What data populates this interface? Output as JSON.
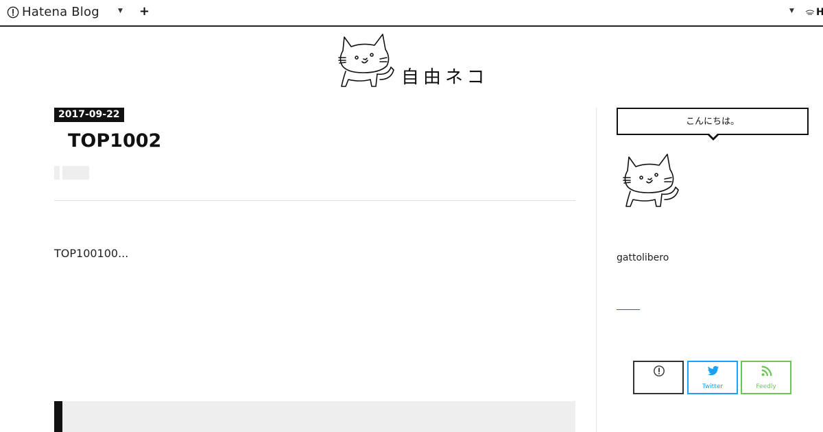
{
  "topbar": {
    "brand": "Hatena Blog",
    "add_label": "+",
    "user_initial": "H"
  },
  "header": {
    "site_title": "自由ネコ"
  },
  "entry": {
    "date": "2017-09-22",
    "title": "TOP1002",
    "body": "TOP100100..."
  },
  "sidebar": {
    "greeting": "こんにちは。",
    "profile_name": "gattolibero",
    "share_buttons": [
      {
        "label": "",
        "icon": "hatena-bookmark-icon",
        "color": "#333333"
      },
      {
        "label": "Twitter",
        "icon": "twitter-icon",
        "color": "#1da1f2"
      },
      {
        "label": "Feedly",
        "icon": "feedly-icon",
        "color": "#6cc655"
      }
    ]
  },
  "colors": {
    "accent": "#111111",
    "twitter": "#1da1f2",
    "feedly": "#6cc655",
    "link": "#3a5ea8"
  }
}
